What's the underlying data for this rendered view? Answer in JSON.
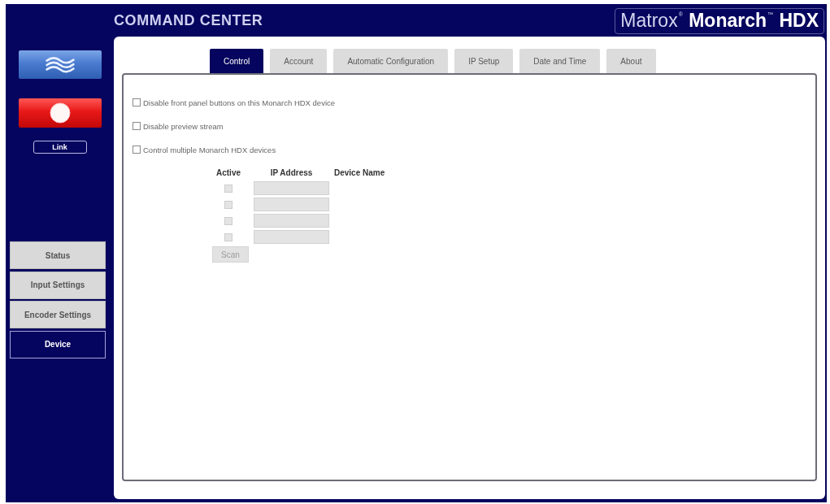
{
  "header": {
    "title": "COMMAND CENTER",
    "logo": "Matrox$^{®}$ **Monarch**$^{™}$ **HDX**"
  },
  "sidebar": {
    "link_button": "Link",
    "nav": [
      {
        "label": "Status",
        "selected": false
      },
      {
        "label": "Input Settings",
        "selected": false
      },
      {
        "label": "Encoder Settings",
        "selected": false
      },
      {
        "label": "Device",
        "selected": true
      }
    ]
  },
  "tabs": [
    {
      "label": "Control",
      "selected": true
    },
    {
      "label": "Account",
      "selected": false
    },
    {
      "label": "Automatic Configuration",
      "selected": false
    },
    {
      "label": "IP Setup",
      "selected": false
    },
    {
      "label": "Date and Time",
      "selected": false
    },
    {
      "label": "About",
      "selected": false
    }
  ],
  "control": {
    "options": [
      {
        "label": "Disable front panel buttons on this Monarch HDX device",
        "checked": false
      },
      {
        "label": "Disable preview stream",
        "checked": false
      },
      {
        "label": "Control multiple Monarch HDX devices",
        "checked": false
      }
    ],
    "device_table": {
      "columns": [
        "Active",
        "IP Address",
        "Device Name"
      ],
      "rows": [
        {
          "active": false,
          "disabled": true
        },
        {
          "active": false,
          "disabled": true
        },
        {
          "active": false,
          "disabled": true
        },
        {
          "active": false,
          "disabled": true
        }
      ]
    },
    "scan_button": {
      "label": "Scan",
      "disabled": true
    }
  }
}
